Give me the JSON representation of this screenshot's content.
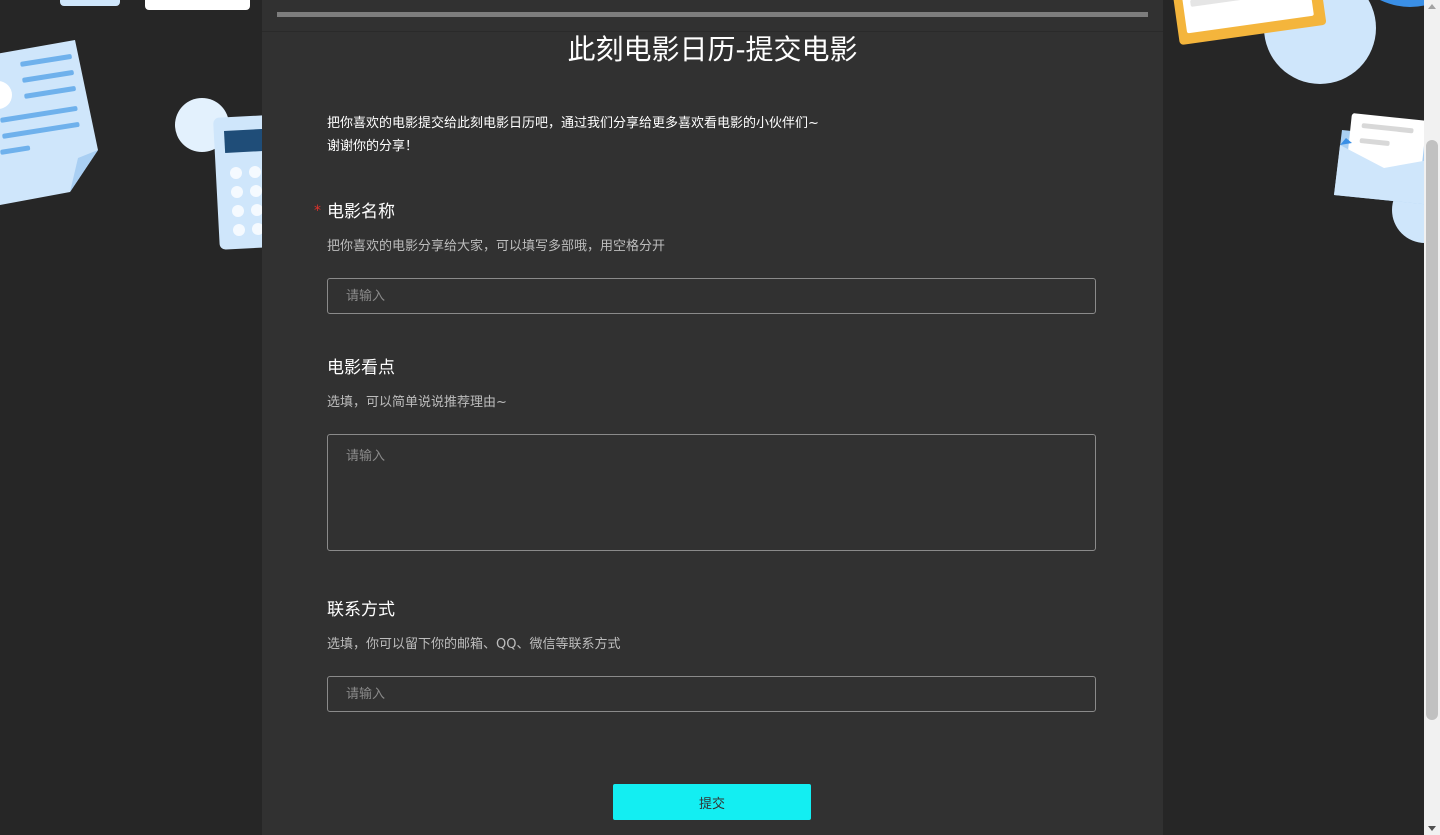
{
  "form": {
    "title": "此刻电影日历-提交电影",
    "intro_line1": "把你喜欢的电影提交给此刻电影日历吧，通过我们分享给更多喜欢看电影的小伙伴们~",
    "intro_line2": "谢谢你的分享！",
    "fields": [
      {
        "label": "电影名称",
        "required_mark": "*",
        "description": "把你喜欢的电影分享给大家，可以填写多部哦，用空格分开",
        "placeholder": "请输入",
        "value": ""
      },
      {
        "label": "电影看点",
        "description": "选填，可以简单说说推荐理由~",
        "placeholder": "请输入",
        "value": ""
      },
      {
        "label": "联系方式",
        "description": "选填，你可以留下你的邮箱、QQ、微信等联系方式",
        "placeholder": "请输入",
        "value": ""
      }
    ],
    "submit_label": "提交"
  },
  "colors": {
    "background": "#262626",
    "card": "#313131",
    "accent_button": "#13eef2",
    "required": "#e0322b"
  },
  "decorations": [
    "document-icon",
    "calculator-icon",
    "envelope-icon",
    "note-card-icon"
  ]
}
